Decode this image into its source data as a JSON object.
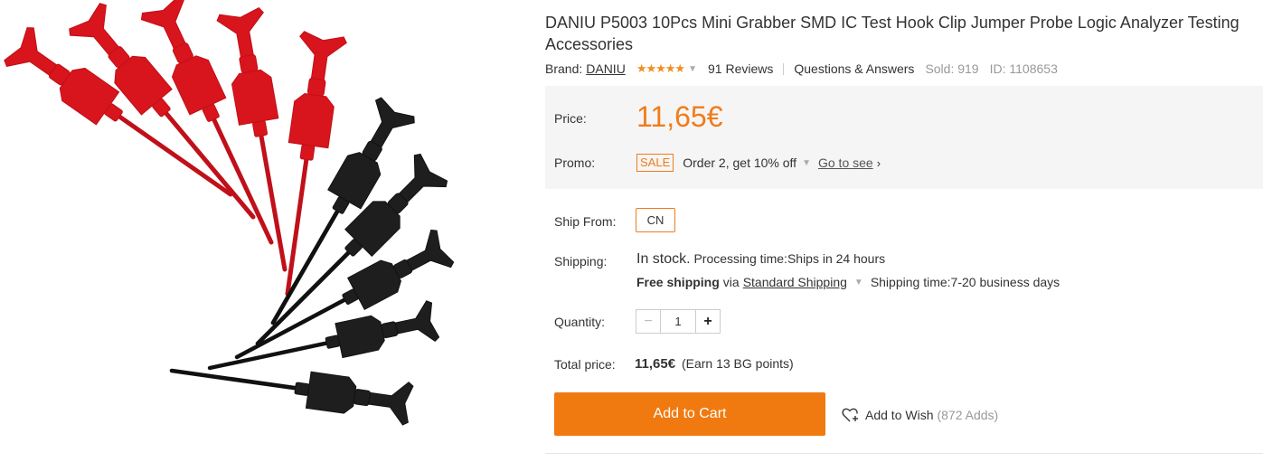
{
  "product": {
    "title": "DANIU P5003 10Pcs Mini Grabber SMD IC Test Hook Clip Jumper Probe Logic Analyzer Testing Accessories",
    "brand_label": "Brand:",
    "brand_name": "DANIU",
    "rating_stars": "★★★★★",
    "reviews": "91 Reviews",
    "qa_link": "Questions & Answers",
    "sold": "Sold: 919",
    "id": "ID: 1108653"
  },
  "price": {
    "label": "Price:",
    "value": "11,65€"
  },
  "promo": {
    "label": "Promo:",
    "badge": "SALE",
    "text": "Order 2, get 10% off",
    "link": "Go to see"
  },
  "ship_from": {
    "label": "Ship From:",
    "option": "CN"
  },
  "shipping": {
    "label": "Shipping:",
    "stock": "In stock.",
    "processing": "Processing time:Ships in 24 hours",
    "free": "Free shipping",
    "via": "via",
    "method": "Standard Shipping",
    "time": "Shipping time:7-20 business days"
  },
  "quantity": {
    "label": "Quantity:",
    "value": "1",
    "minus": "−",
    "plus": "+"
  },
  "total": {
    "label": "Total price:",
    "value": "11,65€",
    "points": "(Earn 13 BG points)"
  },
  "actions": {
    "add_to_cart": "Add to Cart",
    "add_to_wish": "Add to Wish",
    "wish_count": "(872 Adds)"
  },
  "colors": {
    "accent": "#f07a10",
    "price": "#f07c1a",
    "clip_red": "#d8141c",
    "clip_black": "#1c1c1c"
  },
  "icons": {
    "caret": "caret-down-icon",
    "chevron": "chevron-right-icon",
    "heart": "heart-plus-icon"
  }
}
